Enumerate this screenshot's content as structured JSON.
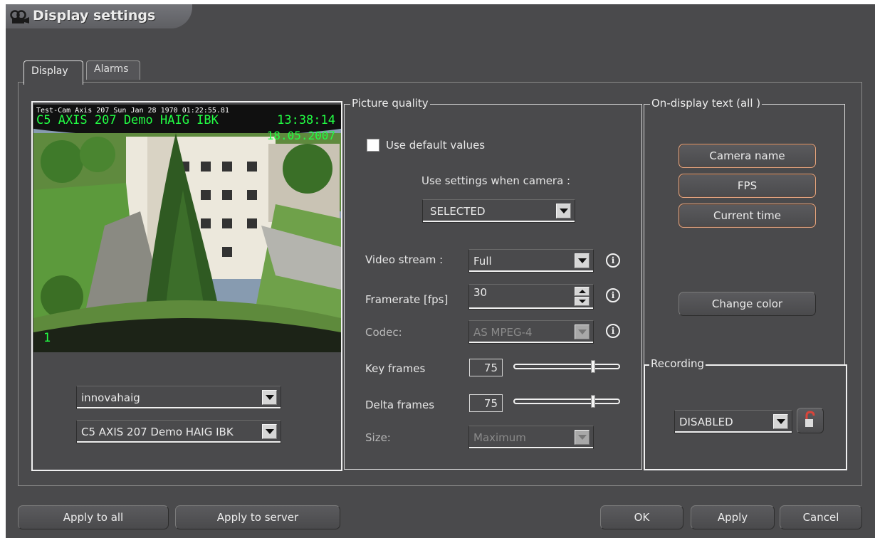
{
  "window": {
    "title": "Display settings",
    "title_icon": "camera-icon"
  },
  "tabs": [
    {
      "label": "Display",
      "active": true
    },
    {
      "label": "Alarms",
      "active": false
    }
  ],
  "video": {
    "overlay_top": "Test-Cam Axis 207 Sun Jan 28 1970 01:22:55.81",
    "camera_name": "C5 AXIS 207 Demo HAIG IBK",
    "time": "13:38:14",
    "date": "18.05.2007",
    "fps": "1"
  },
  "left": {
    "server_select": "innovahaig",
    "camera_select": "C5 AXIS 207 Demo HAIG IBK"
  },
  "picture_quality": {
    "title": "Picture quality",
    "use_default_label": "Use default values",
    "use_default_checked": false,
    "use_settings_label": "Use settings when camera :",
    "use_settings_value": "SELECTED",
    "video_stream_label": "Video stream :",
    "video_stream_value": "Full",
    "framerate_label": "Framerate [fps]",
    "framerate_value": "30",
    "codec_label": "Codec:",
    "codec_value": "AS MPEG-4",
    "keyframes_label": "Key frames",
    "keyframes_value": "75",
    "deltaframes_label": "Delta frames",
    "deltaframes_value": "75",
    "size_label": "Size:",
    "size_value": "Maximum"
  },
  "on_display": {
    "title": "On-display text (all )",
    "camera_name_btn": "Camera name",
    "fps_btn": "FPS",
    "current_time_btn": "Current time",
    "change_color_btn": "Change color"
  },
  "recording": {
    "title": "Recording",
    "value": "DISABLED"
  },
  "footer": {
    "apply_all": "Apply to all",
    "apply_server": "Apply to server",
    "ok": "OK",
    "apply": "Apply",
    "cancel": "Cancel"
  },
  "colors": {
    "background": "#4a4a4c",
    "accent_orange": "#e3a47f",
    "overlay_green": "#22ff44"
  }
}
